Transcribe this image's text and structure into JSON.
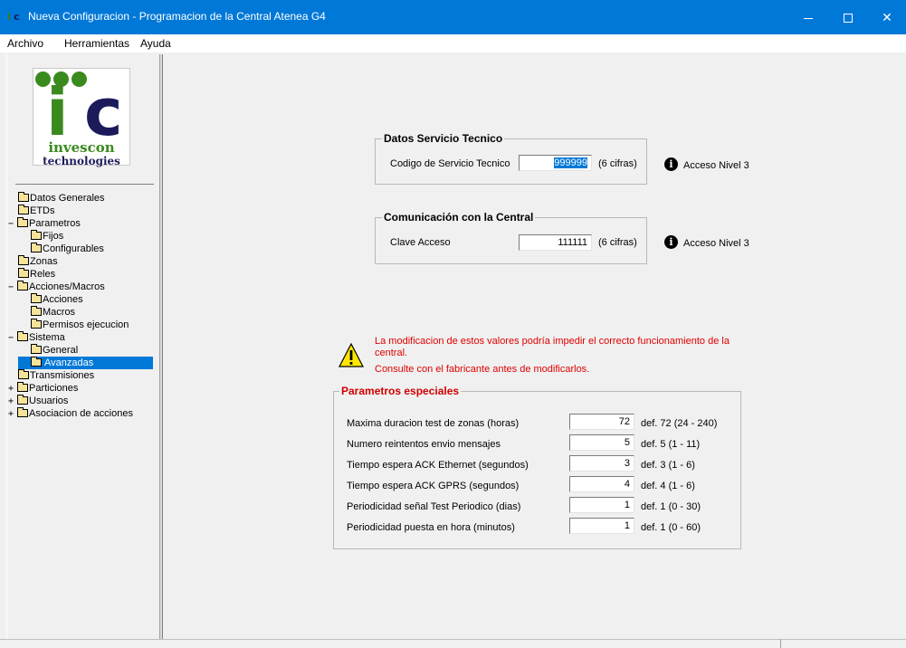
{
  "window": {
    "title": "Nueva Configuracion - Programacion de la Central Atenea G4",
    "icon_letters": "ic"
  },
  "menu": {
    "archivo": "Archivo",
    "herramientas": "Herramientas",
    "ayuda": "Ayuda"
  },
  "logo": {
    "letters_i": "i",
    "letters_c": "c",
    "line1": "invescon",
    "line2": "technologies"
  },
  "tree": {
    "items": [
      {
        "label": "Datos Generales",
        "toggle": ""
      },
      {
        "label": "ETDs",
        "toggle": ""
      },
      {
        "label": "Parametros",
        "toggle": "−"
      },
      {
        "label": "Fijos",
        "toggle": ""
      },
      {
        "label": "Configurables",
        "toggle": ""
      },
      {
        "label": "Zonas",
        "toggle": ""
      },
      {
        "label": "Reles",
        "toggle": ""
      },
      {
        "label": "Acciones/Macros",
        "toggle": "−"
      },
      {
        "label": "Acciones",
        "toggle": ""
      },
      {
        "label": "Macros",
        "toggle": ""
      },
      {
        "label": "Permisos ejecucion",
        "toggle": ""
      },
      {
        "label": "Sistema",
        "toggle": "−"
      },
      {
        "label": "General",
        "toggle": ""
      },
      {
        "label": "Avanzadas",
        "toggle": ""
      },
      {
        "label": "Transmisiones",
        "toggle": ""
      },
      {
        "label": "Particiones",
        "toggle": "+"
      },
      {
        "label": "Usuarios",
        "toggle": "+"
      },
      {
        "label": "Asociacion de acciones",
        "toggle": "+"
      }
    ]
  },
  "servicio": {
    "legend": "Datos Servicio Tecnico",
    "label": "Codigo de Servicio Tecnico",
    "value": "999999",
    "hint": "(6 cifras)",
    "access": "Acceso Nivel 3"
  },
  "comunicacion": {
    "legend": "Comunicación con la Central",
    "label": "Clave Acceso",
    "value": "111111",
    "hint": "(6 cifras)",
    "access": "Acceso Nivel 3"
  },
  "warning": {
    "line1": "La modificacion de estos valores podría impedir el correcto funcionamiento de la",
    "line2": "central.",
    "line3": "Consulte con el fabricante antes de modificarlos."
  },
  "especiales": {
    "legend": "Parametros especiales",
    "rows": [
      {
        "label": "Maxima duracion test de zonas (horas)",
        "value": "72",
        "def": "def. 72  (24 - 240)"
      },
      {
        "label": "Numero reintentos envio mensajes",
        "value": "5",
        "def": "def. 5  (1 - 11)"
      },
      {
        "label": "Tiempo espera ACK Ethernet (segundos)",
        "value": "3",
        "def": "def. 3  (1 - 6)"
      },
      {
        "label": "Tiempo espera ACK GPRS  (segundos)",
        "value": "4",
        "def": "def. 4  (1 - 6)"
      },
      {
        "label": "Periodicidad señal Test Periodico (dias)",
        "value": "1",
        "def": "def. 1  (0 - 30)"
      },
      {
        "label": "Periodicidad puesta en hora (minutos)",
        "value": "1",
        "def": "def. 1  (0 - 60)"
      }
    ]
  },
  "colors": {
    "titlebar": "#0078d7",
    "selection": "#0078d7",
    "warning_text": "#e00000",
    "logo_green": "#3a8a1e",
    "logo_navy": "#1b1b5c"
  },
  "icons": [
    "app-logo-icon",
    "minimize-icon",
    "maximize-icon",
    "close-icon",
    "folder-icon",
    "info-icon",
    "warning-icon"
  ]
}
